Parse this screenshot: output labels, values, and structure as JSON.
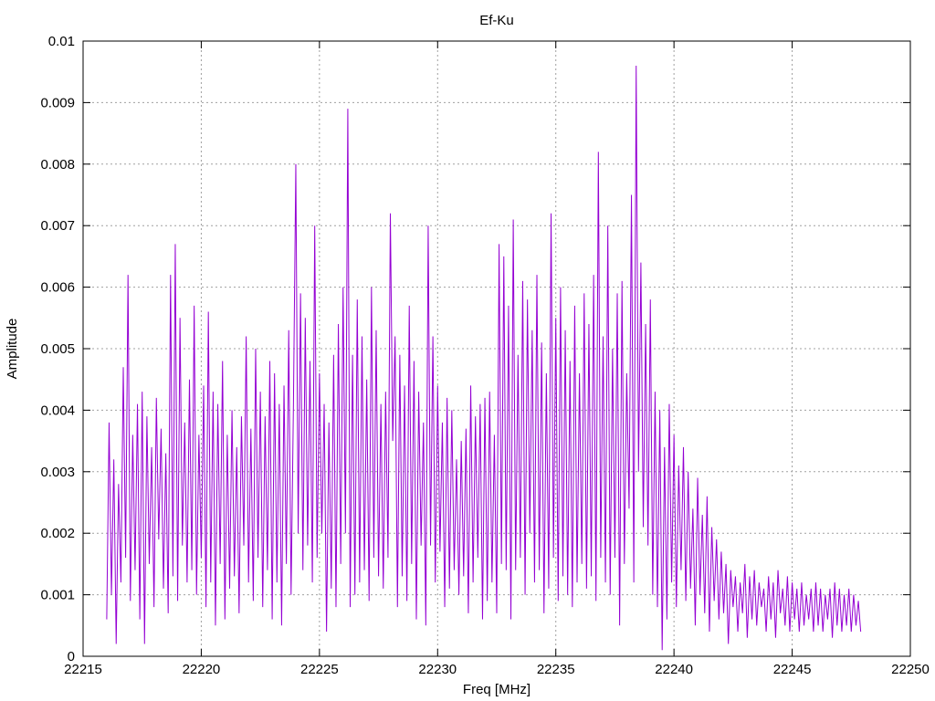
{
  "chart_data": {
    "type": "line",
    "title": "Ef-Ku",
    "xlabel": "Freq [MHz]",
    "ylabel": "Amplitude",
    "xlim": [
      22215,
      22250
    ],
    "ylim": [
      0,
      0.01
    ],
    "x_ticks": [
      "22215",
      "22220",
      "22225",
      "22230",
      "22235",
      "22240",
      "22245",
      "22250"
    ],
    "y_ticks": [
      "0",
      "0.001",
      "0.002",
      "0.003",
      "0.004",
      "0.005",
      "0.006",
      "0.007",
      "0.008",
      "0.009",
      "0.01"
    ],
    "grid": true,
    "line_color": "#9400d3",
    "series": [
      {
        "x": [
          22216.0,
          22216.1,
          22216.2,
          22216.3,
          22216.4,
          22216.5,
          22216.6,
          22216.7,
          22216.8,
          22216.9,
          22217.0,
          22217.1,
          22217.2,
          22217.3,
          22217.4,
          22217.5,
          22217.6,
          22217.7,
          22217.8,
          22217.9,
          22218.0,
          22218.1,
          22218.2,
          22218.3,
          22218.4,
          22218.5,
          22218.6,
          22218.7,
          22218.8,
          22218.9,
          22219.0,
          22219.1,
          22219.2,
          22219.3,
          22219.4,
          22219.5,
          22219.6,
          22219.7,
          22219.8,
          22219.9,
          22220.0,
          22220.1,
          22220.2,
          22220.3,
          22220.4,
          22220.5,
          22220.6,
          22220.7,
          22220.8,
          22220.9,
          22221.0,
          22221.1,
          22221.2,
          22221.3,
          22221.4,
          22221.5,
          22221.6,
          22221.7,
          22221.8,
          22221.9,
          22222.0,
          22222.1,
          22222.2,
          22222.3,
          22222.4,
          22222.5,
          22222.6,
          22222.7,
          22222.8,
          22222.9,
          22223.0,
          22223.1,
          22223.2,
          22223.3,
          22223.4,
          22223.5,
          22223.6,
          22223.7,
          22223.8,
          22223.9,
          22224.0,
          22224.1,
          22224.2,
          22224.3,
          22224.4,
          22224.5,
          22224.6,
          22224.7,
          22224.8,
          22224.9,
          22225.0,
          22225.1,
          22225.2,
          22225.3,
          22225.4,
          22225.5,
          22225.6,
          22225.7,
          22225.8,
          22225.9,
          22226.0,
          22226.1,
          22226.2,
          22226.3,
          22226.4,
          22226.5,
          22226.6,
          22226.7,
          22226.8,
          22226.9,
          22227.0,
          22227.1,
          22227.2,
          22227.3,
          22227.4,
          22227.5,
          22227.6,
          22227.7,
          22227.8,
          22227.9,
          22228.0,
          22228.1,
          22228.2,
          22228.3,
          22228.4,
          22228.5,
          22228.6,
          22228.7,
          22228.8,
          22228.9,
          22229.0,
          22229.1,
          22229.2,
          22229.3,
          22229.4,
          22229.5,
          22229.6,
          22229.7,
          22229.8,
          22229.9,
          22230.0,
          22230.1,
          22230.2,
          22230.3,
          22230.4,
          22230.5,
          22230.6,
          22230.7,
          22230.8,
          22230.9,
          22231.0,
          22231.1,
          22231.2,
          22231.3,
          22231.4,
          22231.5,
          22231.6,
          22231.7,
          22231.8,
          22231.9,
          22232.0,
          22232.1,
          22232.2,
          22232.3,
          22232.4,
          22232.5,
          22232.6,
          22232.7,
          22232.8,
          22232.9,
          22233.0,
          22233.1,
          22233.2,
          22233.3,
          22233.4,
          22233.5,
          22233.6,
          22233.7,
          22233.8,
          22233.9,
          22234.0,
          22234.1,
          22234.2,
          22234.3,
          22234.4,
          22234.5,
          22234.6,
          22234.7,
          22234.8,
          22234.9,
          22235.0,
          22235.1,
          22235.2,
          22235.3,
          22235.4,
          22235.5,
          22235.6,
          22235.7,
          22235.8,
          22235.9,
          22236.0,
          22236.1,
          22236.2,
          22236.3,
          22236.4,
          22236.5,
          22236.6,
          22236.7,
          22236.8,
          22236.9,
          22237.0,
          22237.1,
          22237.2,
          22237.3,
          22237.4,
          22237.5,
          22237.6,
          22237.7,
          22237.8,
          22237.9,
          22238.0,
          22238.1,
          22238.2,
          22238.3,
          22238.4,
          22238.5,
          22238.6,
          22238.7,
          22238.8,
          22238.9,
          22239.0,
          22239.1,
          22239.2,
          22239.3,
          22239.4,
          22239.5,
          22239.6,
          22239.7,
          22239.8,
          22239.9,
          22240.0,
          22240.1,
          22240.2,
          22240.3,
          22240.4,
          22240.5,
          22240.6,
          22240.7,
          22240.8,
          22240.9,
          22241.0,
          22241.1,
          22241.2,
          22241.3,
          22241.4,
          22241.5,
          22241.6,
          22241.7,
          22241.8,
          22241.9,
          22242.0,
          22242.1,
          22242.2,
          22242.3,
          22242.4,
          22242.5,
          22242.6,
          22242.7,
          22242.8,
          22242.9,
          22243.0,
          22243.1,
          22243.2,
          22243.3,
          22243.4,
          22243.5,
          22243.6,
          22243.7,
          22243.8,
          22243.9,
          22244.0,
          22244.1,
          22244.2,
          22244.3,
          22244.4,
          22244.5,
          22244.6,
          22244.7,
          22244.8,
          22244.9,
          22245.0,
          22245.1,
          22245.2,
          22245.3,
          22245.4,
          22245.5,
          22245.6,
          22245.7,
          22245.8,
          22245.9,
          22246.0,
          22246.1,
          22246.2,
          22246.3,
          22246.4,
          22246.5,
          22246.6,
          22246.7,
          22246.8,
          22246.9,
          22247.0,
          22247.1,
          22247.2,
          22247.3,
          22247.4,
          22247.5,
          22247.6,
          22247.7,
          22247.8,
          22247.9
        ],
        "y": [
          0.0006,
          0.0038,
          0.001,
          0.0032,
          0.0002,
          0.0028,
          0.0012,
          0.0047,
          0.0016,
          0.0062,
          0.0009,
          0.0036,
          0.0014,
          0.0041,
          0.0006,
          0.0043,
          0.0002,
          0.0039,
          0.0015,
          0.0034,
          0.0008,
          0.0042,
          0.0019,
          0.0037,
          0.0011,
          0.0033,
          0.0007,
          0.0062,
          0.0013,
          0.0067,
          0.0009,
          0.0055,
          0.0018,
          0.0038,
          0.0012,
          0.0045,
          0.0014,
          0.0057,
          0.001,
          0.0036,
          0.0016,
          0.0044,
          0.0008,
          0.0056,
          0.0012,
          0.0043,
          0.0005,
          0.0041,
          0.0015,
          0.0048,
          0.0006,
          0.0036,
          0.0011,
          0.004,
          0.0013,
          0.0034,
          0.0007,
          0.0039,
          0.0018,
          0.0052,
          0.0012,
          0.0037,
          0.0009,
          0.005,
          0.0016,
          0.0043,
          0.0008,
          0.0039,
          0.0014,
          0.0048,
          0.0006,
          0.0046,
          0.0012,
          0.0041,
          0.0005,
          0.0044,
          0.0015,
          0.0053,
          0.001,
          0.0041,
          0.008,
          0.002,
          0.0059,
          0.0014,
          0.0055,
          0.0018,
          0.0048,
          0.0012,
          0.007,
          0.0016,
          0.0046,
          0.002,
          0.0041,
          0.0004,
          0.0038,
          0.0011,
          0.0049,
          0.0008,
          0.0054,
          0.0015,
          0.006,
          0.002,
          0.0089,
          0.0008,
          0.0049,
          0.001,
          0.0058,
          0.0012,
          0.0052,
          0.0014,
          0.0045,
          0.0009,
          0.006,
          0.0016,
          0.0053,
          0.0013,
          0.0041,
          0.0011,
          0.0043,
          0.0016,
          0.0072,
          0.0035,
          0.0052,
          0.0008,
          0.0049,
          0.0013,
          0.0044,
          0.0009,
          0.0057,
          0.0015,
          0.0048,
          0.0006,
          0.0043,
          0.0018,
          0.0038,
          0.0005,
          0.007,
          0.0018,
          0.0052,
          0.0012,
          0.0044,
          0.0017,
          0.0038,
          0.0008,
          0.0042,
          0.0011,
          0.004,
          0.0014,
          0.0032,
          0.001,
          0.0035,
          0.0013,
          0.0037,
          0.0007,
          0.0044,
          0.0012,
          0.0039,
          0.0016,
          0.0041,
          0.0006,
          0.0042,
          0.0009,
          0.0043,
          0.0012,
          0.0036,
          0.0007,
          0.0067,
          0.0015,
          0.0065,
          0.0014,
          0.0057,
          0.0006,
          0.0071,
          0.0014,
          0.0049,
          0.0016,
          0.0061,
          0.001,
          0.0058,
          0.002,
          0.0053,
          0.0012,
          0.0062,
          0.0014,
          0.0051,
          0.0007,
          0.0046,
          0.0011,
          0.0072,
          0.0016,
          0.0055,
          0.0009,
          0.006,
          0.0013,
          0.0053,
          0.001,
          0.0048,
          0.0008,
          0.0057,
          0.0012,
          0.0046,
          0.0015,
          0.0059,
          0.0011,
          0.0054,
          0.0013,
          0.0062,
          0.0009,
          0.0082,
          0.0016,
          0.0052,
          0.0012,
          0.007,
          0.001,
          0.005,
          0.0016,
          0.0059,
          0.0005,
          0.0061,
          0.0015,
          0.0046,
          0.0024,
          0.0075,
          0.0012,
          0.0096,
          0.003,
          0.0064,
          0.0021,
          0.0054,
          0.0018,
          0.0058,
          0.001,
          0.0043,
          0.0008,
          0.004,
          0.0001,
          0.0034,
          0.0006,
          0.0041,
          0.0012,
          0.0036,
          0.0008,
          0.0031,
          0.0014,
          0.0034,
          0.0009,
          0.003,
          0.0011,
          0.0024,
          0.0005,
          0.0029,
          0.001,
          0.0023,
          0.0007,
          0.0026,
          0.0004,
          0.0021,
          0.0009,
          0.0019,
          0.0006,
          0.0017,
          0.0007,
          0.0015,
          0.0002,
          0.0014,
          0.0008,
          0.0013,
          0.0004,
          0.0012,
          0.0007,
          0.0015,
          0.0003,
          0.0013,
          0.0006,
          0.0014,
          0.0005,
          0.0012,
          0.0008,
          0.0011,
          0.0004,
          0.0013,
          0.0006,
          0.0012,
          0.0003,
          0.0014,
          0.0007,
          0.0011,
          0.0005,
          0.0013,
          0.0004,
          0.0012,
          0.0006,
          0.0011,
          0.0004,
          0.0012,
          0.0005,
          0.001,
          0.0006,
          0.0011,
          0.0004,
          0.0012,
          0.0005,
          0.0011,
          0.0004,
          0.001,
          0.0006,
          0.0011,
          0.0003,
          0.0012,
          0.0005,
          0.0011,
          0.0004,
          0.001,
          0.0005,
          0.0011,
          0.0004,
          0.001,
          0.0005,
          0.0009,
          0.0004
        ]
      }
    ]
  }
}
